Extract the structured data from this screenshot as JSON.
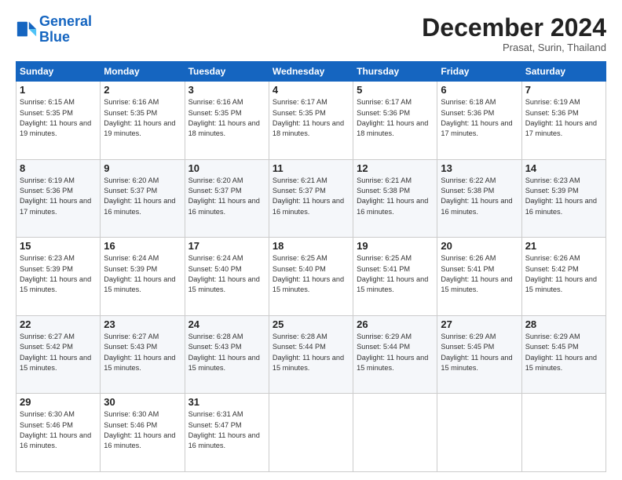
{
  "logo": {
    "line1": "General",
    "line2": "Blue"
  },
  "header": {
    "month": "December 2024",
    "location": "Prasat, Surin, Thailand"
  },
  "weekdays": [
    "Sunday",
    "Monday",
    "Tuesday",
    "Wednesday",
    "Thursday",
    "Friday",
    "Saturday"
  ],
  "weeks": [
    [
      {
        "day": "1",
        "sunrise": "Sunrise: 6:15 AM",
        "sunset": "Sunset: 5:35 PM",
        "daylight": "Daylight: 11 hours and 19 minutes."
      },
      {
        "day": "2",
        "sunrise": "Sunrise: 6:16 AM",
        "sunset": "Sunset: 5:35 PM",
        "daylight": "Daylight: 11 hours and 19 minutes."
      },
      {
        "day": "3",
        "sunrise": "Sunrise: 6:16 AM",
        "sunset": "Sunset: 5:35 PM",
        "daylight": "Daylight: 11 hours and 18 minutes."
      },
      {
        "day": "4",
        "sunrise": "Sunrise: 6:17 AM",
        "sunset": "Sunset: 5:35 PM",
        "daylight": "Daylight: 11 hours and 18 minutes."
      },
      {
        "day": "5",
        "sunrise": "Sunrise: 6:17 AM",
        "sunset": "Sunset: 5:36 PM",
        "daylight": "Daylight: 11 hours and 18 minutes."
      },
      {
        "day": "6",
        "sunrise": "Sunrise: 6:18 AM",
        "sunset": "Sunset: 5:36 PM",
        "daylight": "Daylight: 11 hours and 17 minutes."
      },
      {
        "day": "7",
        "sunrise": "Sunrise: 6:19 AM",
        "sunset": "Sunset: 5:36 PM",
        "daylight": "Daylight: 11 hours and 17 minutes."
      }
    ],
    [
      {
        "day": "8",
        "sunrise": "Sunrise: 6:19 AM",
        "sunset": "Sunset: 5:36 PM",
        "daylight": "Daylight: 11 hours and 17 minutes."
      },
      {
        "day": "9",
        "sunrise": "Sunrise: 6:20 AM",
        "sunset": "Sunset: 5:37 PM",
        "daylight": "Daylight: 11 hours and 16 minutes."
      },
      {
        "day": "10",
        "sunrise": "Sunrise: 6:20 AM",
        "sunset": "Sunset: 5:37 PM",
        "daylight": "Daylight: 11 hours and 16 minutes."
      },
      {
        "day": "11",
        "sunrise": "Sunrise: 6:21 AM",
        "sunset": "Sunset: 5:37 PM",
        "daylight": "Daylight: 11 hours and 16 minutes."
      },
      {
        "day": "12",
        "sunrise": "Sunrise: 6:21 AM",
        "sunset": "Sunset: 5:38 PM",
        "daylight": "Daylight: 11 hours and 16 minutes."
      },
      {
        "day": "13",
        "sunrise": "Sunrise: 6:22 AM",
        "sunset": "Sunset: 5:38 PM",
        "daylight": "Daylight: 11 hours and 16 minutes."
      },
      {
        "day": "14",
        "sunrise": "Sunrise: 6:23 AM",
        "sunset": "Sunset: 5:39 PM",
        "daylight": "Daylight: 11 hours and 16 minutes."
      }
    ],
    [
      {
        "day": "15",
        "sunrise": "Sunrise: 6:23 AM",
        "sunset": "Sunset: 5:39 PM",
        "daylight": "Daylight: 11 hours and 15 minutes."
      },
      {
        "day": "16",
        "sunrise": "Sunrise: 6:24 AM",
        "sunset": "Sunset: 5:39 PM",
        "daylight": "Daylight: 11 hours and 15 minutes."
      },
      {
        "day": "17",
        "sunrise": "Sunrise: 6:24 AM",
        "sunset": "Sunset: 5:40 PM",
        "daylight": "Daylight: 11 hours and 15 minutes."
      },
      {
        "day": "18",
        "sunrise": "Sunrise: 6:25 AM",
        "sunset": "Sunset: 5:40 PM",
        "daylight": "Daylight: 11 hours and 15 minutes."
      },
      {
        "day": "19",
        "sunrise": "Sunrise: 6:25 AM",
        "sunset": "Sunset: 5:41 PM",
        "daylight": "Daylight: 11 hours and 15 minutes."
      },
      {
        "day": "20",
        "sunrise": "Sunrise: 6:26 AM",
        "sunset": "Sunset: 5:41 PM",
        "daylight": "Daylight: 11 hours and 15 minutes."
      },
      {
        "day": "21",
        "sunrise": "Sunrise: 6:26 AM",
        "sunset": "Sunset: 5:42 PM",
        "daylight": "Daylight: 11 hours and 15 minutes."
      }
    ],
    [
      {
        "day": "22",
        "sunrise": "Sunrise: 6:27 AM",
        "sunset": "Sunset: 5:42 PM",
        "daylight": "Daylight: 11 hours and 15 minutes."
      },
      {
        "day": "23",
        "sunrise": "Sunrise: 6:27 AM",
        "sunset": "Sunset: 5:43 PM",
        "daylight": "Daylight: 11 hours and 15 minutes."
      },
      {
        "day": "24",
        "sunrise": "Sunrise: 6:28 AM",
        "sunset": "Sunset: 5:43 PM",
        "daylight": "Daylight: 11 hours and 15 minutes."
      },
      {
        "day": "25",
        "sunrise": "Sunrise: 6:28 AM",
        "sunset": "Sunset: 5:44 PM",
        "daylight": "Daylight: 11 hours and 15 minutes."
      },
      {
        "day": "26",
        "sunrise": "Sunrise: 6:29 AM",
        "sunset": "Sunset: 5:44 PM",
        "daylight": "Daylight: 11 hours and 15 minutes."
      },
      {
        "day": "27",
        "sunrise": "Sunrise: 6:29 AM",
        "sunset": "Sunset: 5:45 PM",
        "daylight": "Daylight: 11 hours and 15 minutes."
      },
      {
        "day": "28",
        "sunrise": "Sunrise: 6:29 AM",
        "sunset": "Sunset: 5:45 PM",
        "daylight": "Daylight: 11 hours and 15 minutes."
      }
    ],
    [
      {
        "day": "29",
        "sunrise": "Sunrise: 6:30 AM",
        "sunset": "Sunset: 5:46 PM",
        "daylight": "Daylight: 11 hours and 16 minutes."
      },
      {
        "day": "30",
        "sunrise": "Sunrise: 6:30 AM",
        "sunset": "Sunset: 5:46 PM",
        "daylight": "Daylight: 11 hours and 16 minutes."
      },
      {
        "day": "31",
        "sunrise": "Sunrise: 6:31 AM",
        "sunset": "Sunset: 5:47 PM",
        "daylight": "Daylight: 11 hours and 16 minutes."
      },
      null,
      null,
      null,
      null
    ]
  ]
}
